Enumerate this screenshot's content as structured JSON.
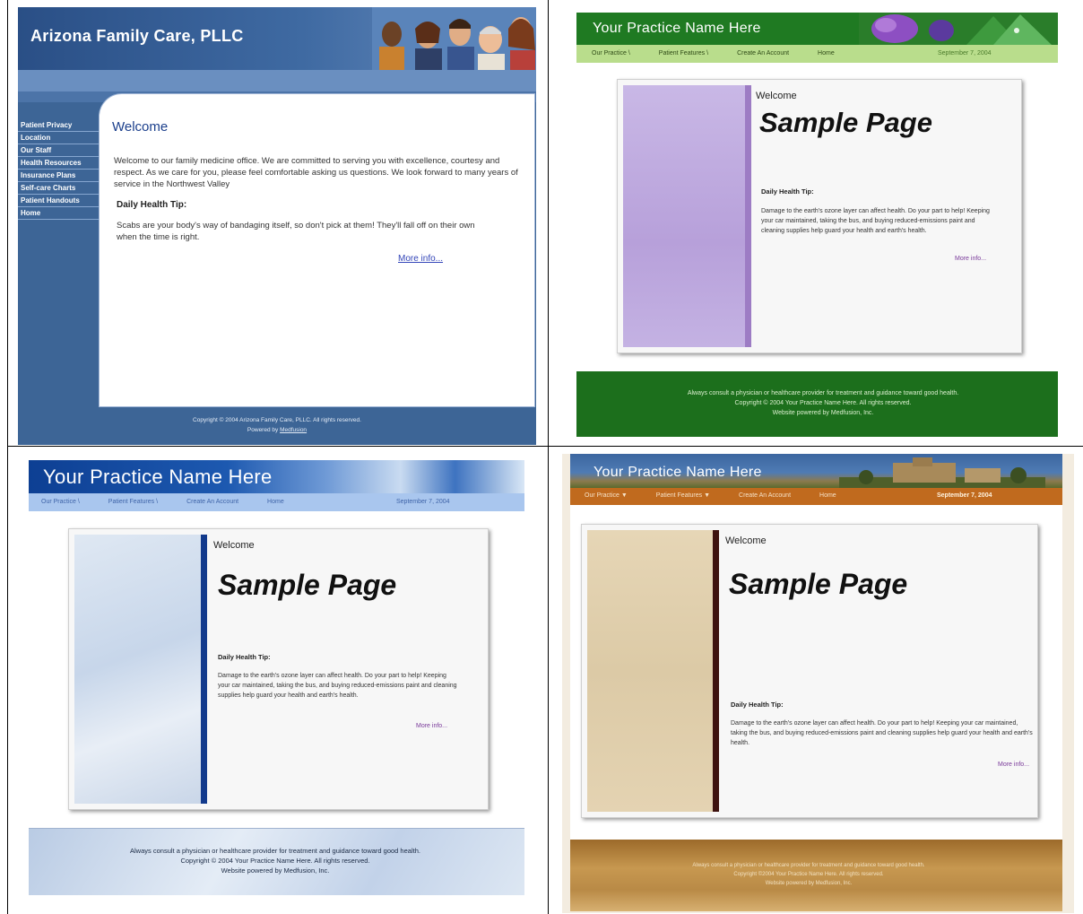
{
  "panel1": {
    "title": "Arizona Family Care, PLLC",
    "nav": [
      "Patient Privacy",
      "Location",
      "Our Staff",
      "Health Resources",
      "Insurance Plans",
      "Self-care Charts",
      "Patient Handouts",
      "Home"
    ],
    "welcome": "Welcome",
    "intro": "Welcome to our family medicine office. We are committed to serving you with excellence, courtesy and respect. As we care for you, please feel comfortable asking us questions. We look forward to many years of service in the Northwest Valley",
    "tip_heading": "Daily Health Tip:",
    "tip": "Scabs are your body's way of bandaging itself, so don't pick at them! They'll fall off on their own when the time is right.",
    "more": "More info...",
    "footer_line1": "Copyright © 2004 Arizona Family Care, PLLC. All rights reserved.",
    "footer_powered": "Powered by",
    "footer_link": "Medfusion"
  },
  "panel2": {
    "title": "Your Practice Name Here",
    "nav": [
      "Our Practice \\",
      "Patient Features \\",
      "Create An Account",
      "Home"
    ],
    "date": "September 7, 2004",
    "welcome": "Welcome",
    "sample": "Sample Page",
    "tip_heading": "Daily Health Tip:",
    "tip": "Damage to the earth's ozone layer can affect health. Do your part to help! Keeping your car maintained, taking the bus, and buying reduced-emissions paint and cleaning supplies help guard your health and earth's health.",
    "more": "More info...",
    "footer": [
      "Always consult a physician or healthcare provider for treatment and guidance toward good health.",
      "Copyright © 2004 Your Practice Name Here. All rights reserved.",
      "Website powered by Medfusion, Inc."
    ]
  },
  "panel3": {
    "title": "Your Practice Name Here",
    "nav": [
      "Our Practice \\",
      "Patient Features \\",
      "Create An Account",
      "Home"
    ],
    "date": "September 7, 2004",
    "welcome": "Welcome",
    "sample": "Sample Page",
    "tip_heading": "Daily Health Tip:",
    "tip": "Damage to the earth's ozone layer can affect health. Do your part to help! Keeping your car maintained, taking the bus, and buying reduced-emissions paint and cleaning supplies help guard your health and earth's health.",
    "more": "More info...",
    "footer": [
      "Always consult a physician or healthcare provider for treatment and guidance toward good health.",
      "Copyright © 2004 Your Practice Name Here. All rights reserved.",
      "Website powered by Medfusion, Inc."
    ]
  },
  "panel4": {
    "title": "Your Practice Name Here",
    "nav": [
      "Our Practice ▼",
      "Patient Features ▼",
      "Create An Account",
      "Home"
    ],
    "date": "September 7, 2004",
    "welcome": "Welcome",
    "sample": "Sample Page",
    "tip_heading": "Daily Health Tip:",
    "tip": "Damage to the earth's ozone layer can affect health. Do your part to help! Keeping your car maintained, taking the bus, and buying reduced-emissions paint and cleaning supplies help guard your health and earth's health.",
    "more": "More info...",
    "footer": [
      "Always consult a physician or healthcare provider for treatment and guidance toward good health.",
      "Copyright ©2004 Your Practice Name Here. All rights reserved.",
      "Website powered by Medfusion, Inc."
    ]
  },
  "colors": {
    "arizona_blue": "#3d6596",
    "green_header": "#1f7a22",
    "blue_header": "#0d3f93",
    "brown_nav": "#c06a1e"
  }
}
